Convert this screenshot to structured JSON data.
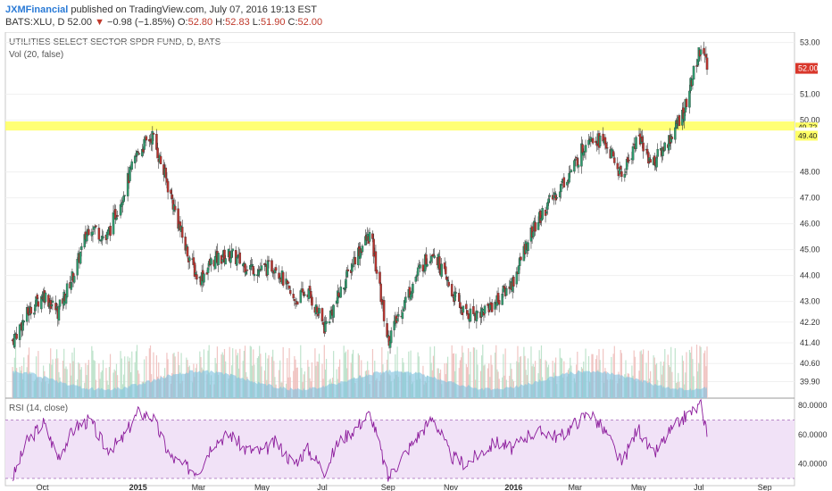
{
  "header": {
    "author": "JXMFinancial",
    "published_text": "published on TradingView.com, July 07, 2016 19:13 EST",
    "symbol": "BATS:XLU, D",
    "last": "52.00",
    "change_arrow": "▼",
    "change": "−0.98 (−1.85%)",
    "o_label": "O:",
    "o_value": "52.80",
    "h_label": "H:",
    "h_value": "52.83",
    "l_label": "L:",
    "l_value": "51.90",
    "c_label": "C:",
    "c_value": "52.00"
  },
  "chart_data": [
    {
      "type": "candlestick",
      "title": "UTILITIES SELECT SECTOR SPDR FUND, D, BATS",
      "subtitle": "Vol (20, false)",
      "x_ticks": [
        "Oct",
        "2015",
        "Mar",
        "May",
        "Jul",
        "Sep",
        "Nov",
        "2016",
        "Mar",
        "May",
        "Jul",
        "Sep"
      ],
      "y_ticks": [
        "53.00",
        "51.00",
        "50.00",
        "48.00",
        "47.00",
        "46.00",
        "45.00",
        "44.00",
        "43.00",
        "42.20",
        "41.40",
        "40.60",
        "39.90"
      ],
      "ylim": [
        39.4,
        53.4
      ],
      "last_price_label": "52.00",
      "resistance_zone": [
        49.6,
        49.95
      ],
      "price_labels": [
        "49.72",
        "49.60",
        "49.48",
        "49.40"
      ],
      "approx_closes": [
        [
          "2014-09-01",
          41.5
        ],
        [
          "2014-09-15",
          42.5
        ],
        [
          "2014-10-01",
          43.3
        ],
        [
          "2014-10-15",
          42.6
        ],
        [
          "2014-11-01",
          44.2
        ],
        [
          "2014-11-15",
          46.0
        ],
        [
          "2014-12-01",
          45.4
        ],
        [
          "2014-12-15",
          46.9
        ],
        [
          "2015-01-01",
          48.8
        ],
        [
          "2015-01-15",
          49.4
        ],
        [
          "2015-02-01",
          47.2
        ],
        [
          "2015-02-15",
          45.2
        ],
        [
          "2015-03-01",
          43.8
        ],
        [
          "2015-03-15",
          44.6
        ],
        [
          "2015-04-01",
          44.8
        ],
        [
          "2015-04-15",
          44.4
        ],
        [
          "2015-05-01",
          44.2
        ],
        [
          "2015-05-15",
          44.4
        ],
        [
          "2015-06-01",
          43.0
        ],
        [
          "2015-06-15",
          43.4
        ],
        [
          "2015-07-01",
          42.0
        ],
        [
          "2015-07-15",
          43.2
        ],
        [
          "2015-08-01",
          44.8
        ],
        [
          "2015-08-15",
          45.6
        ],
        [
          "2015-09-01",
          41.5
        ],
        [
          "2015-09-15",
          42.8
        ],
        [
          "2015-10-01",
          44.2
        ],
        [
          "2015-10-15",
          45.0
        ],
        [
          "2015-11-01",
          43.4
        ],
        [
          "2015-11-15",
          42.5
        ],
        [
          "2015-12-01",
          42.6
        ],
        [
          "2015-12-15",
          43.0
        ],
        [
          "2016-01-01",
          43.8
        ],
        [
          "2016-01-15",
          45.4
        ],
        [
          "2016-02-01",
          46.6
        ],
        [
          "2016-02-15",
          47.4
        ],
        [
          "2016-03-01",
          48.3
        ],
        [
          "2016-03-15",
          49.5
        ],
        [
          "2016-04-01",
          49.0
        ],
        [
          "2016-04-15",
          47.8
        ],
        [
          "2016-05-01",
          49.4
        ],
        [
          "2016-05-15",
          48.3
        ],
        [
          "2016-06-01",
          49.3
        ],
        [
          "2016-06-15",
          50.4
        ],
        [
          "2016-07-01",
          52.9
        ],
        [
          "2016-07-07",
          52.0
        ]
      ]
    },
    {
      "type": "line",
      "title": "RSI (14, close)",
      "y_ticks": [
        "80.0000",
        "60.0000",
        "40.0000"
      ],
      "ylim": [
        25,
        85
      ],
      "overbought": 70,
      "oversold": 30,
      "approx_values": [
        [
          "2014-09-01",
          30
        ],
        [
          "2014-09-15",
          55
        ],
        [
          "2014-10-01",
          68
        ],
        [
          "2014-10-15",
          45
        ],
        [
          "2014-11-01",
          65
        ],
        [
          "2014-11-15",
          70
        ],
        [
          "2014-12-01",
          50
        ],
        [
          "2014-12-15",
          55
        ],
        [
          "2015-01-01",
          75
        ],
        [
          "2015-01-15",
          72
        ],
        [
          "2015-02-01",
          45
        ],
        [
          "2015-02-15",
          38
        ],
        [
          "2015-03-01",
          35
        ],
        [
          "2015-03-15",
          55
        ],
        [
          "2015-04-01",
          60
        ],
        [
          "2015-04-15",
          50
        ],
        [
          "2015-05-01",
          48
        ],
        [
          "2015-05-15",
          55
        ],
        [
          "2015-06-01",
          40
        ],
        [
          "2015-06-15",
          50
        ],
        [
          "2015-07-01",
          35
        ],
        [
          "2015-07-15",
          55
        ],
        [
          "2015-08-01",
          65
        ],
        [
          "2015-08-15",
          75
        ],
        [
          "2015-09-01",
          30
        ],
        [
          "2015-09-15",
          45
        ],
        [
          "2015-10-01",
          60
        ],
        [
          "2015-10-15",
          72
        ],
        [
          "2015-11-01",
          45
        ],
        [
          "2015-11-15",
          40
        ],
        [
          "2015-12-01",
          48
        ],
        [
          "2015-12-15",
          55
        ],
        [
          "2016-01-01",
          50
        ],
        [
          "2016-01-15",
          60
        ],
        [
          "2016-02-01",
          62
        ],
        [
          "2016-02-15",
          58
        ],
        [
          "2016-03-01",
          68
        ],
        [
          "2016-03-15",
          75
        ],
        [
          "2016-04-01",
          60
        ],
        [
          "2016-04-15",
          40
        ],
        [
          "2016-05-01",
          65
        ],
        [
          "2016-05-15",
          45
        ],
        [
          "2016-06-01",
          62
        ],
        [
          "2016-06-15",
          72
        ],
        [
          "2016-07-01",
          80
        ],
        [
          "2016-07-07",
          62
        ]
      ]
    }
  ],
  "colors": {
    "up": "#2e9c6e",
    "down": "#b8342f",
    "volume": "#7bbfe0",
    "resistance": "#ffff66",
    "rsi_line": "#8b1a9b",
    "rsi_band": "#f1e2f7",
    "last_badge": "#d9372b"
  }
}
